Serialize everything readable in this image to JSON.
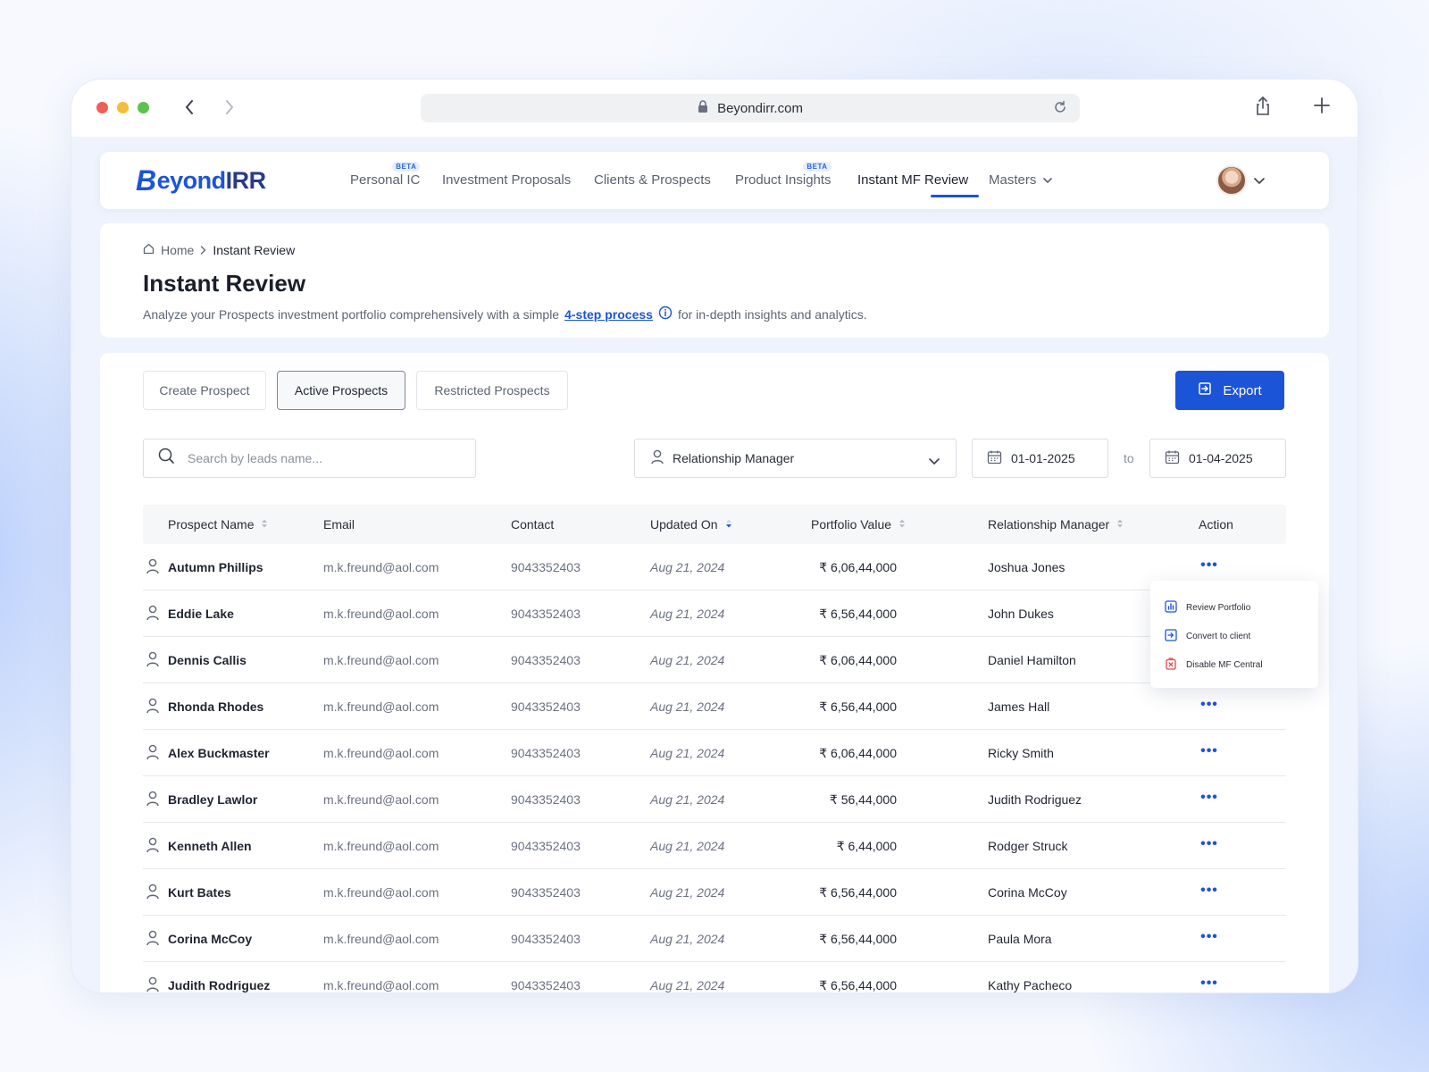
{
  "browser": {
    "url": "Beyondirr.com"
  },
  "app": {
    "logo": {
      "b": "B",
      "eyond": "eyond",
      "irr": "IRR"
    },
    "nav": [
      {
        "label": "Personal IC",
        "badge": "BETA"
      },
      {
        "label": "Investment Proposals"
      },
      {
        "label": "Clients & Prospects"
      },
      {
        "label": "Product Insights",
        "badge": "BETA"
      },
      {
        "label": "Instant MF Review",
        "active": true
      },
      {
        "label": "Masters"
      }
    ]
  },
  "header": {
    "breadcrumb": {
      "home": "Home",
      "current": "Instant Review"
    },
    "title": "Instant Review",
    "subtitle_before": "Analyze your Prospects investment portfolio comprehensively with a simple",
    "subtitle_link": "4-step process",
    "subtitle_after": "for in-depth insights and analytics."
  },
  "tabs": [
    {
      "label": "Create Prospect"
    },
    {
      "label": "Active Prospects",
      "active": true
    },
    {
      "label": "Restricted Prospects"
    }
  ],
  "export_label": "Export",
  "filters": {
    "search_placeholder": "Search by leads name...",
    "rm_label": "Relationship Manager",
    "date_from": "01-01-2025",
    "to_label": "to",
    "date_to": "01-04-2025"
  },
  "table": {
    "columns": [
      "Prospect Name",
      "Email",
      "Contact",
      "Updated On",
      "Portfolio Value",
      "Relationship Manager",
      "Action"
    ],
    "rows": [
      {
        "name": "Autumn Phillips",
        "email": "m.k.freund@aol.com",
        "contact": "9043352403",
        "updated": "Aug 21, 2024",
        "value": "₹ 6,06,44,000",
        "rm": "Joshua Jones"
      },
      {
        "name": "Eddie Lake",
        "email": "m.k.freund@aol.com",
        "contact": "9043352403",
        "updated": "Aug 21, 2024",
        "value": "₹ 6,56,44,000",
        "rm": "John Dukes"
      },
      {
        "name": "Dennis Callis",
        "email": "m.k.freund@aol.com",
        "contact": "9043352403",
        "updated": "Aug 21, 2024",
        "value": "₹ 6,06,44,000",
        "rm": "Daniel Hamilton"
      },
      {
        "name": "Rhonda Rhodes",
        "email": "m.k.freund@aol.com",
        "contact": "9043352403",
        "updated": "Aug 21, 2024",
        "value": "₹ 6,56,44,000",
        "rm": "James Hall"
      },
      {
        "name": "Alex Buckmaster",
        "email": "m.k.freund@aol.com",
        "contact": "9043352403",
        "updated": "Aug 21, 2024",
        "value": "₹ 6,06,44,000",
        "rm": "Ricky Smith"
      },
      {
        "name": "Bradley Lawlor",
        "email": "m.k.freund@aol.com",
        "contact": "9043352403",
        "updated": "Aug 21, 2024",
        "value": "₹ 56,44,000",
        "rm": "Judith Rodriguez"
      },
      {
        "name": "Kenneth Allen",
        "email": "m.k.freund@aol.com",
        "contact": "9043352403",
        "updated": "Aug 21, 2024",
        "value": "₹ 6,44,000",
        "rm": "Rodger Struck"
      },
      {
        "name": "Kurt Bates",
        "email": "m.k.freund@aol.com",
        "contact": "9043352403",
        "updated": "Aug 21, 2024",
        "value": "₹ 6,56,44,000",
        "rm": "Corina McCoy"
      },
      {
        "name": "Corina McCoy",
        "email": "m.k.freund@aol.com",
        "contact": "9043352403",
        "updated": "Aug 21, 2024",
        "value": "₹ 6,56,44,000",
        "rm": "Paula Mora"
      },
      {
        "name": "Judith Rodriguez",
        "email": "m.k.freund@aol.com",
        "contact": "9043352403",
        "updated": "Aug 21, 2024",
        "value": "₹ 6,56,44,000",
        "rm": "Kathy Pacheco"
      }
    ],
    "action_glyph": "•••"
  },
  "action_menu": {
    "items": [
      {
        "label": "Review Portfolio",
        "icon": "chart-icon"
      },
      {
        "label": "Convert to client",
        "icon": "convert-icon"
      },
      {
        "label": "Disable MF Central",
        "icon": "disable-icon"
      }
    ]
  },
  "colors": {
    "accent": "#1c54d8",
    "danger": "#e0474c"
  }
}
